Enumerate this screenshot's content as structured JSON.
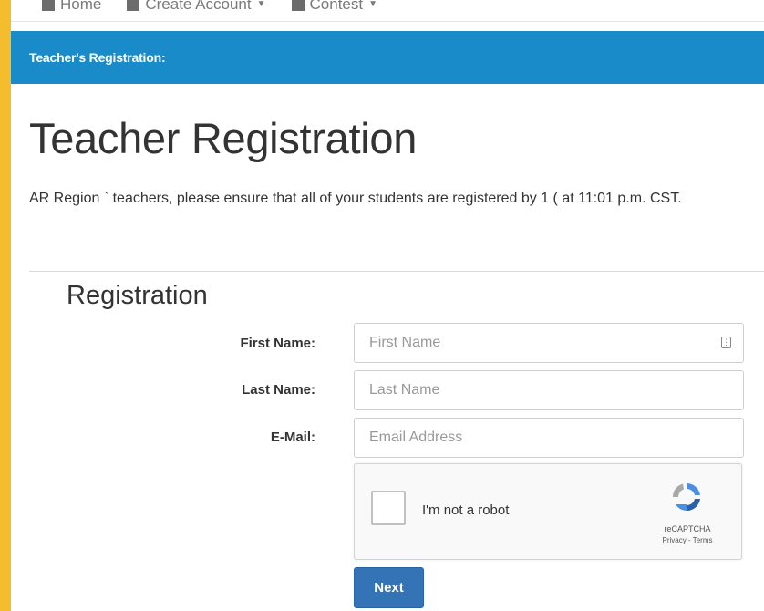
{
  "nav": {
    "items": [
      {
        "label": "Home",
        "icon": "home-icon"
      },
      {
        "label": "Create Account",
        "icon": "user-icon"
      },
      {
        "label": "Contest",
        "icon": "trophy-icon"
      }
    ]
  },
  "banner": {
    "title": "Teacher's Registration:"
  },
  "page": {
    "title": "Teacher Registration",
    "intro": "AR Region `  teachers, please ensure that all of your students are registered by 1 ( at 11:01 p.m. CST."
  },
  "form": {
    "section_title": "Registration",
    "first_name": {
      "label": "First Name:",
      "placeholder": "First Name",
      "value": ""
    },
    "last_name": {
      "label": "Last Name:",
      "placeholder": "Last Name",
      "value": ""
    },
    "email": {
      "label": "E-Mail:",
      "placeholder": "Email Address",
      "value": ""
    },
    "captcha": {
      "label": "I'm not a robot",
      "brand": "reCAPTCHA",
      "terms": "Privacy - Terms"
    },
    "next_label": "Next"
  },
  "colors": {
    "page_border": "#f3bd2e",
    "banner": "#1a8bc9",
    "button": "#3373b6"
  }
}
